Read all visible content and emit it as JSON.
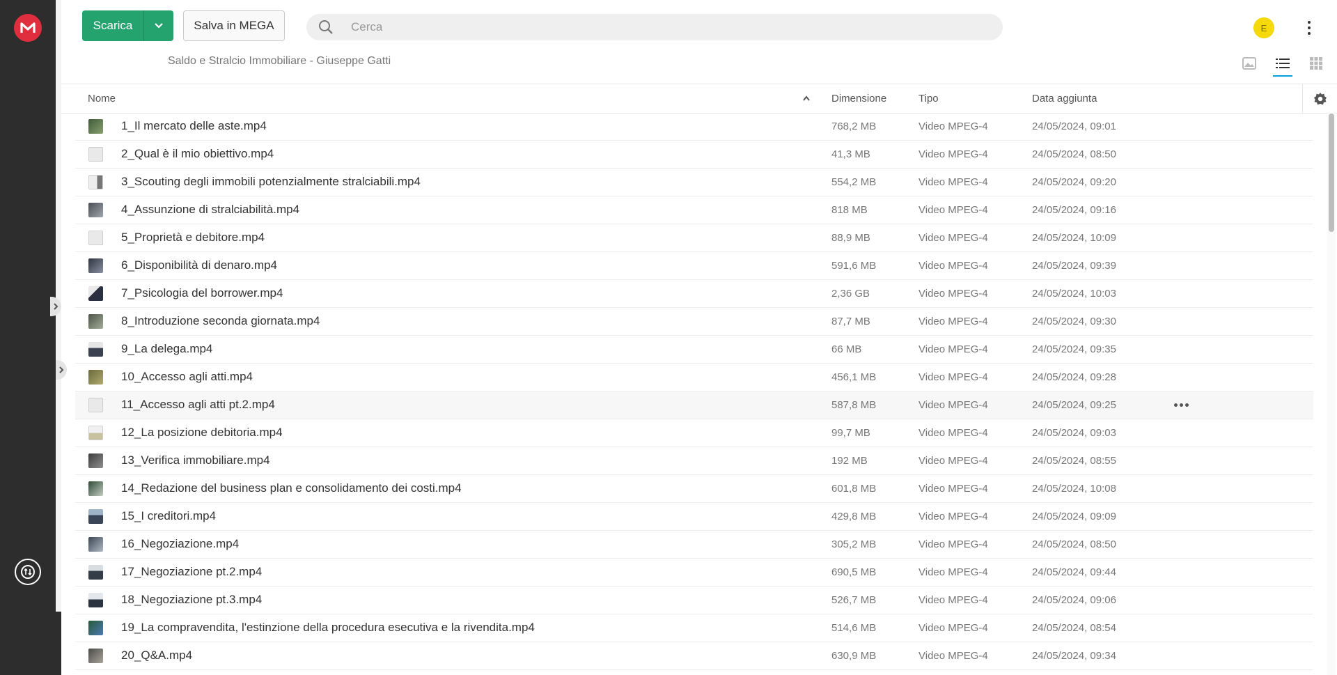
{
  "app": {
    "logo_letter": "M",
    "brand_color": "#e02e3f"
  },
  "toolbar": {
    "download_label": "Scarica",
    "save_label": "Salva in MEGA"
  },
  "search": {
    "placeholder": "Cerca",
    "value": ""
  },
  "user": {
    "initial": "E",
    "avatar_color": "#f5d90a"
  },
  "folder": {
    "title": "Saldo e Stralcio Immobiliare - Giuseppe Gatti"
  },
  "views": [
    "thumbnail-view-icon",
    "list-view-icon",
    "grid-view-icon"
  ],
  "table": {
    "columns": {
      "name": "Nome",
      "size": "Dimensione",
      "type": "Tipo",
      "date": "Data aggiunta"
    },
    "rows": [
      {
        "name": "1_Il mercato delle aste.mp4",
        "size": "768,2 MB",
        "type": "Video MPEG-4",
        "date": "24/05/2024, 09:01"
      },
      {
        "name": "2_Qual è il mio obiettivo.mp4",
        "size": "41,3 MB",
        "type": "Video MPEG-4",
        "date": "24/05/2024, 08:50"
      },
      {
        "name": "3_Scouting degli immobili potenzialmente stralciabili.mp4",
        "size": "554,2 MB",
        "type": "Video MPEG-4",
        "date": "24/05/2024, 09:20"
      },
      {
        "name": "4_Assunzione di stralciabilità.mp4",
        "size": "818 MB",
        "type": "Video MPEG-4",
        "date": "24/05/2024, 09:16"
      },
      {
        "name": "5_Proprietà e debitore.mp4",
        "size": "88,9 MB",
        "type": "Video MPEG-4",
        "date": "24/05/2024, 10:09"
      },
      {
        "name": "6_Disponibilità di denaro.mp4",
        "size": "591,6 MB",
        "type": "Video MPEG-4",
        "date": "24/05/2024, 09:39"
      },
      {
        "name": "7_Psicologia del borrower.mp4",
        "size": "2,36 GB",
        "type": "Video MPEG-4",
        "date": "24/05/2024, 10:03"
      },
      {
        "name": "8_Introduzione seconda giornata.mp4",
        "size": "87,7 MB",
        "type": "Video MPEG-4",
        "date": "24/05/2024, 09:30"
      },
      {
        "name": "9_La delega.mp4",
        "size": "66 MB",
        "type": "Video MPEG-4",
        "date": "24/05/2024, 09:35"
      },
      {
        "name": "10_Accesso agli atti.mp4",
        "size": "456,1 MB",
        "type": "Video MPEG-4",
        "date": "24/05/2024, 09:28"
      },
      {
        "name": "11_Accesso agli atti pt.2.mp4",
        "size": "587,8 MB",
        "type": "Video MPEG-4",
        "date": "24/05/2024, 09:25"
      },
      {
        "name": "12_La posizione debitoria.mp4",
        "size": "99,7 MB",
        "type": "Video MPEG-4",
        "date": "24/05/2024, 09:03"
      },
      {
        "name": "13_Verifica immobiliare.mp4",
        "size": "192 MB",
        "type": "Video MPEG-4",
        "date": "24/05/2024, 08:55"
      },
      {
        "name": "14_Redazione del business plan e consolidamento dei costi.mp4",
        "size": "601,8 MB",
        "type": "Video MPEG-4",
        "date": "24/05/2024, 10:08"
      },
      {
        "name": "15_I creditori.mp4",
        "size": "429,8 MB",
        "type": "Video MPEG-4",
        "date": "24/05/2024, 09:09"
      },
      {
        "name": "16_Negoziazione.mp4",
        "size": "305,2 MB",
        "type": "Video MPEG-4",
        "date": "24/05/2024, 08:50"
      },
      {
        "name": "17_Negoziazione pt.2.mp4",
        "size": "690,5 MB",
        "type": "Video MPEG-4",
        "date": "24/05/2024, 09:44"
      },
      {
        "name": "18_Negoziazione pt.3.mp4",
        "size": "526,7 MB",
        "type": "Video MPEG-4",
        "date": "24/05/2024, 09:06"
      },
      {
        "name": "19_La compravendita, l'estinzione della procedura esecutiva e la rivendita.mp4",
        "size": "514,6 MB",
        "type": "Video MPEG-4",
        "date": "24/05/2024, 08:54"
      },
      {
        "name": "20_Q&A.mp4",
        "size": "630,9 MB",
        "type": "Video MPEG-4",
        "date": "24/05/2024, 09:34"
      }
    ]
  }
}
